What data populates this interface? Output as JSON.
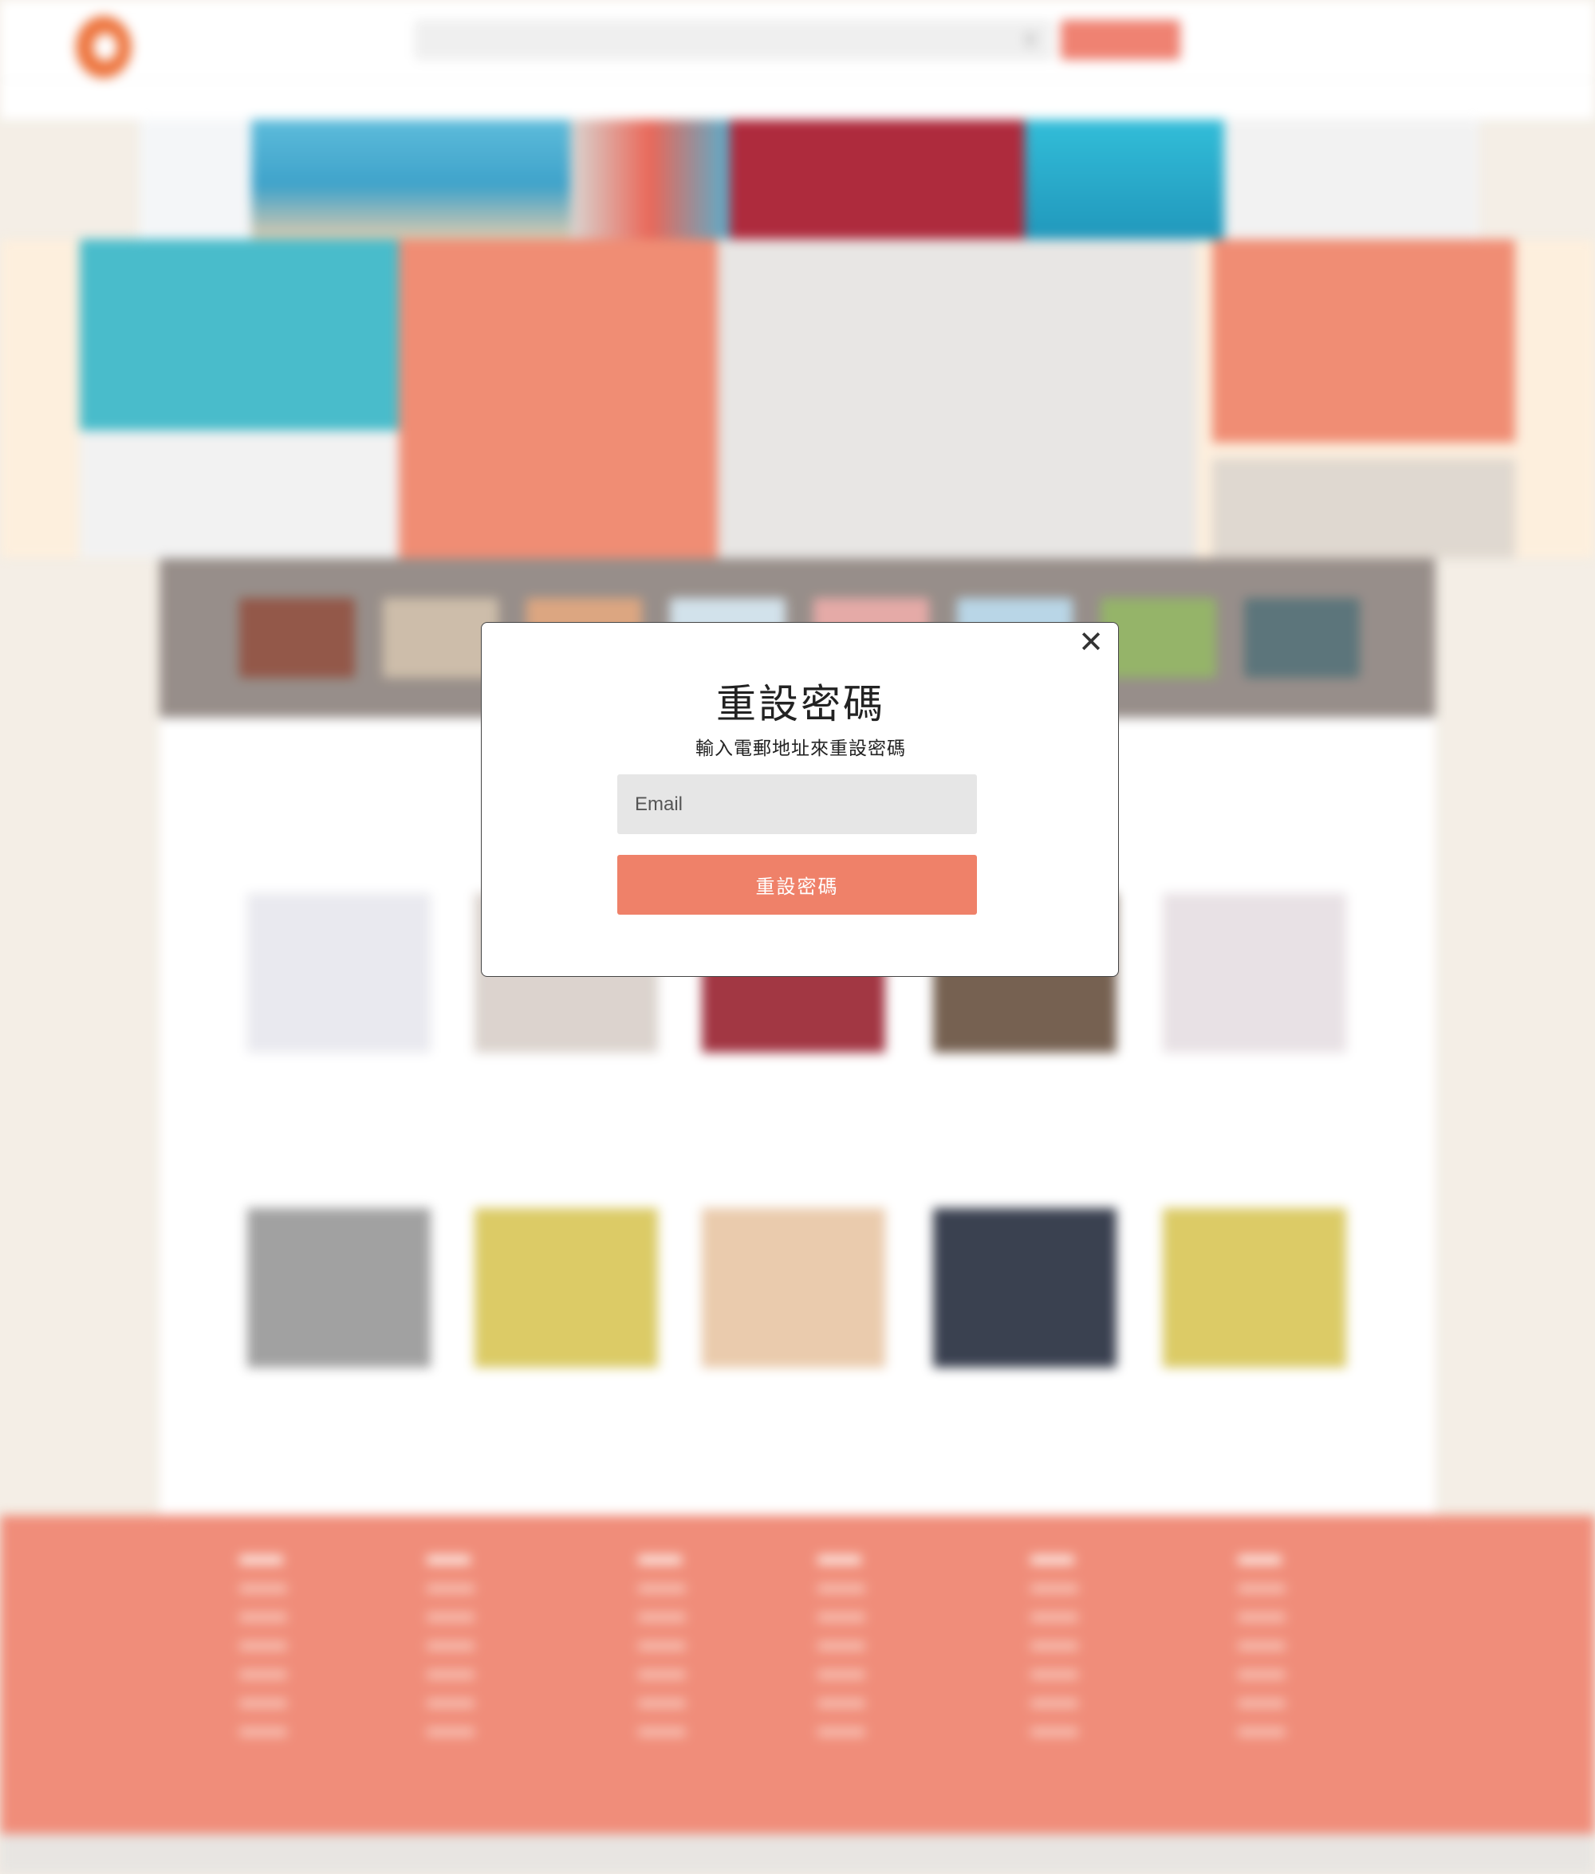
{
  "background": {
    "note_blurred": true
  },
  "modal": {
    "title": "重設密碼",
    "subtitle": "輸入電郵地址來重設密碼",
    "email_placeholder": "Email",
    "email_value": "",
    "submit_label": "重設密碼",
    "close_icon": "close-icon"
  },
  "colors": {
    "accent": "#ef8169",
    "footer": "#ef846f",
    "tv_band": "#8f8580",
    "hero_bg": "#fdeedb"
  }
}
